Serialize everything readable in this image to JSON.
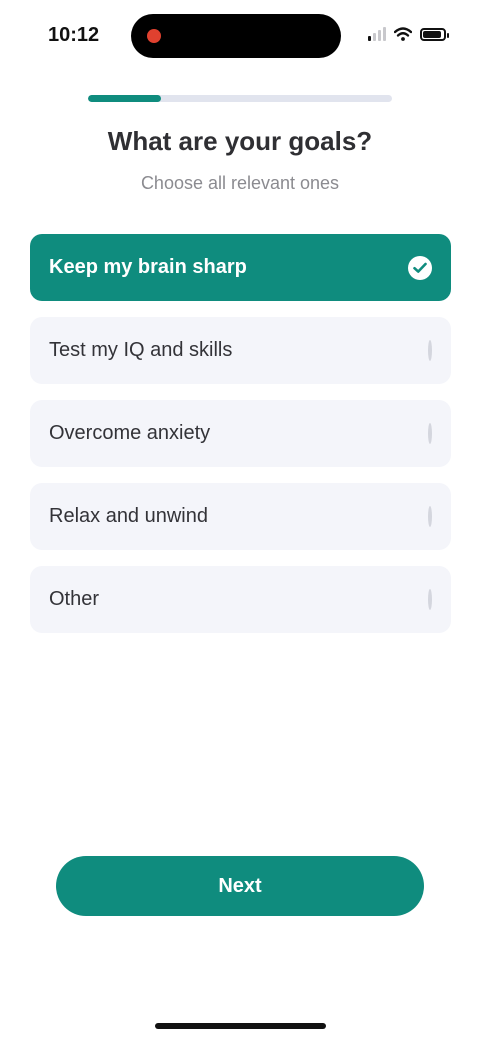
{
  "status_bar": {
    "time": "10:12"
  },
  "progress": {
    "fraction": 0.24
  },
  "header": {
    "title": "What are your goals?",
    "subtitle": "Choose all relevant ones"
  },
  "options": [
    {
      "label": "Keep my brain sharp",
      "selected": true
    },
    {
      "label": "Test my IQ and skills",
      "selected": false
    },
    {
      "label": "Overcome anxiety",
      "selected": false
    },
    {
      "label": "Relax and unwind",
      "selected": false
    },
    {
      "label": "Other",
      "selected": false
    }
  ],
  "footer": {
    "next_label": "Next"
  },
  "colors": {
    "accent": "#0f8c7e",
    "option_bg": "#f4f5fa",
    "recording_dot": "#e0412f"
  }
}
